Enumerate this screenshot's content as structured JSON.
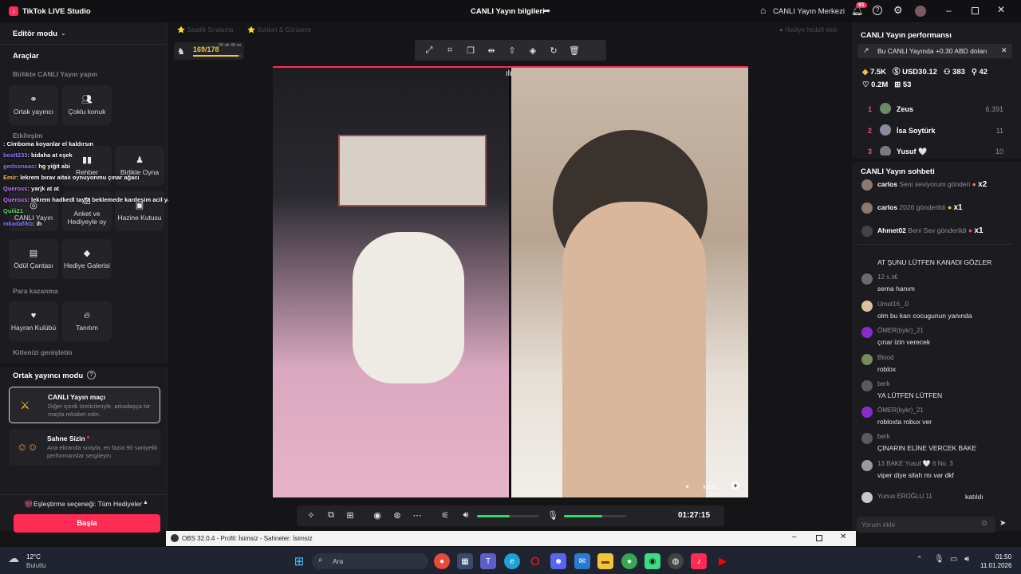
{
  "app": {
    "title": "TikTok LIVE Studio",
    "center_title": "CANLI Yayın bilgileri",
    "live_center": "CANLI Yayın Merkezi",
    "notif_count": "91"
  },
  "left": {
    "editor_mode": "Editör modu",
    "tools": "Araçlar",
    "together_section": "Birlikte CANLI Yayın yapın",
    "cohost": "Ortak yayıncı",
    "multi_guest": "Çoklu konuk",
    "interaction_section": "Etkileşim",
    "guide": "Rehber",
    "play_together": "Birlikte Oyna",
    "live_q": "CANLI Yayın",
    "poll": "Anket ve Hediyeyle oy",
    "treasure": "Hazine Kutusu",
    "reward_bag": "Ödül Çantası",
    "gift_gallery": "Hediye Galerisi",
    "monetize_section": "Para kazanma",
    "fan_club": "Hayran Kulübü",
    "promote": "Tanıtım",
    "expand_audience": "Kitlenizi genişletin",
    "cohost_mode": "Ortak yayıncı modu",
    "match_title": "CANLI Yayın maçı",
    "match_desc": "Diğer içerik üreticileriyle, arkadaşça bir maçta rekabet edin.",
    "stage_title": "Sahne Sizin",
    "stage_desc": "Ana ekranda sırayla, en fazia 90 saniyelik performanslar sergileyin.",
    "match_option": "Eşleştirme seçeneği: Tüm Hediyeler",
    "start": "Başla"
  },
  "overlay_chat": [
    {
      "user": "",
      "text": "Cimboma koyanlar el kaldırsın"
    },
    {
      "user": "bestt233",
      "text": "bidaha at eşek"
    },
    {
      "user": "gedsonaao",
      "text": "hg yiğit abi"
    },
    {
      "user": "Emir",
      "text": "lekrem bırav aitaiı oynuyonmu çınar ağacı"
    },
    {
      "user": "Queroxs",
      "text": "yarjk at at"
    },
    {
      "user": "Queroxs",
      "text": "lekrem hadkedl tayfa beklemede kardeşim acil yayını kapat on ve on oynayalım hemen"
    },
    {
      "user": "Quili21",
      "text": ""
    },
    {
      "user": "mkadafikb",
      "text": "ih"
    }
  ],
  "center": {
    "goal_left": "Saatlik Sıralama",
    "goal_mid": "Sohbet & Görüşme",
    "goal_right": "Hediye hedefi ekle",
    "progress_text": "169/178",
    "progress_time": "00 dk 49 sn",
    "progress_value": 0.95,
    "partner_label": "xxse...",
    "timer": "01:27:15",
    "speaker_level": 0.52,
    "mic_level": 0.62
  },
  "obs": {
    "title": "OBS 32.0.4 - Profil: İsimsiz - Sahneler: İsimsiz"
  },
  "right": {
    "perf_title": "CANLI Yayın performansı",
    "banner": "Bu CANLI Yayında +0.30 ABD doları",
    "stats": [
      "7.5K",
      "USD30.12",
      "383",
      "42",
      "0.2M",
      "53"
    ],
    "ranking": [
      {
        "rank": "1",
        "name": "Zeus",
        "value": "6.391"
      },
      {
        "rank": "2",
        "name": "İsa Soytürk",
        "value": "11"
      },
      {
        "rank": "3",
        "name": "Yusuf 🤍",
        "value": "10"
      }
    ],
    "chat_title": "CANLI Yayın sohbeti",
    "gifts": [
      {
        "user": "carlos",
        "text": "Seni seviyorum gönderi",
        "count": "x2"
      },
      {
        "user": "carlos",
        "text": "2026 gönderildi",
        "count": "x1"
      },
      {
        "user": "Ahmet02",
        "text": "Beni Sev gönderildi",
        "count": "x1"
      }
    ],
    "comments": [
      {
        "user": "",
        "text": "AT ŞUNU LÜTFEN KANADI GÖZLER"
      },
      {
        "user": "12 ꜱ.ᴣ€",
        "text": "sema hanım"
      },
      {
        "user": "Umut16_.0",
        "text": "olm bu karı cocugunun yanında"
      },
      {
        "user": "ÖMER(bykr)_21",
        "text": "çınar izin verecek"
      },
      {
        "user": "Blood",
        "text": "roblox"
      },
      {
        "user": "berk",
        "text": "YA LÜTFEN LÜTFEN"
      },
      {
        "user": "ÖMER(bykr)_21",
        "text": "robloxta robux ver"
      },
      {
        "user": "berk",
        "text": "ÇINARIN ELİNE VERCEK BAKE"
      },
      {
        "user": "13 BAKE Yusuf 🤍 6 No. 3",
        "text": "viper diye silah mı var dkf"
      },
      {
        "user": "Yunus EROĞLU 11",
        "text": "katıldı"
      }
    ],
    "comment_placeholder": "Yorum ekle"
  },
  "taskbar": {
    "temp": "12°C",
    "weather": "Bulutlu",
    "search": "Ara",
    "time": "01:50",
    "date": "11.01.2026"
  },
  "colors": {
    "accent": "#fe2c55",
    "progress": "#f2c43a",
    "level": "#2ee06a",
    "ranking": "#e05a6a",
    "mode_icon": "#ffcc33"
  }
}
